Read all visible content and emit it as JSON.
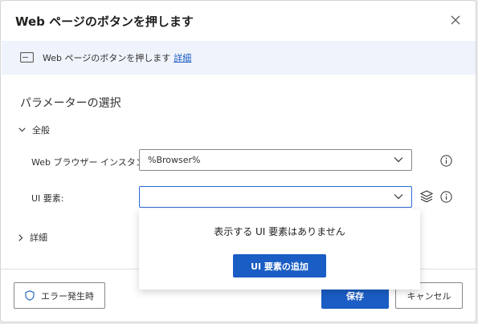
{
  "dialog": {
    "title": "Web ページのボタンを押します",
    "close_icon": "close-icon"
  },
  "info_bar": {
    "icon": "browser-window-icon",
    "text": "Web ページのボタンを押します",
    "link": "詳細"
  },
  "parameters": {
    "section_title": "パラメーターの選択",
    "general_label": "全般",
    "browser_instance": {
      "label": "Web ブラウザー インスタンス:",
      "value": "%Browser%"
    },
    "ui_element": {
      "label": "UI 要素:",
      "value": ""
    },
    "details_label": "詳細"
  },
  "popup": {
    "message": "表示する UI 要素はありません",
    "add_button": "UI 要素の追加"
  },
  "footer": {
    "error_button": "エラー発生時",
    "save_button": "保存",
    "cancel_button": "キャンセル"
  },
  "colors": {
    "accent": "#1a5dc4",
    "info_bar_bg": "#eff3fb"
  }
}
